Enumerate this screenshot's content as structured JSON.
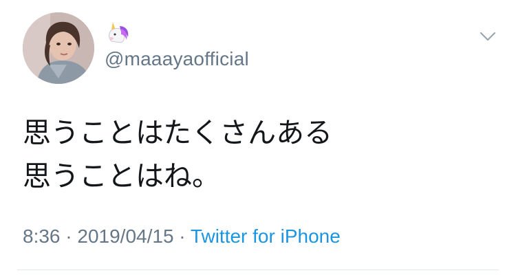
{
  "user": {
    "name_emoji": "🦄",
    "handle": "@maaayaofficial"
  },
  "icons": {
    "avatar": "profile-photo",
    "name_emoji": "unicorn-icon",
    "menu": "chevron-down-icon"
  },
  "tweet": {
    "lines": [
      "思うことはたくさんある",
      "思うことはね。"
    ]
  },
  "meta": {
    "time": "8:36",
    "separator1": " · ",
    "date": "2019/04/15",
    "separator2": " · ",
    "source": "Twitter for iPhone"
  },
  "colors": {
    "text": "#14171a",
    "secondary": "#657786",
    "link": "#1b95e0",
    "divider": "#e1e8ed"
  }
}
